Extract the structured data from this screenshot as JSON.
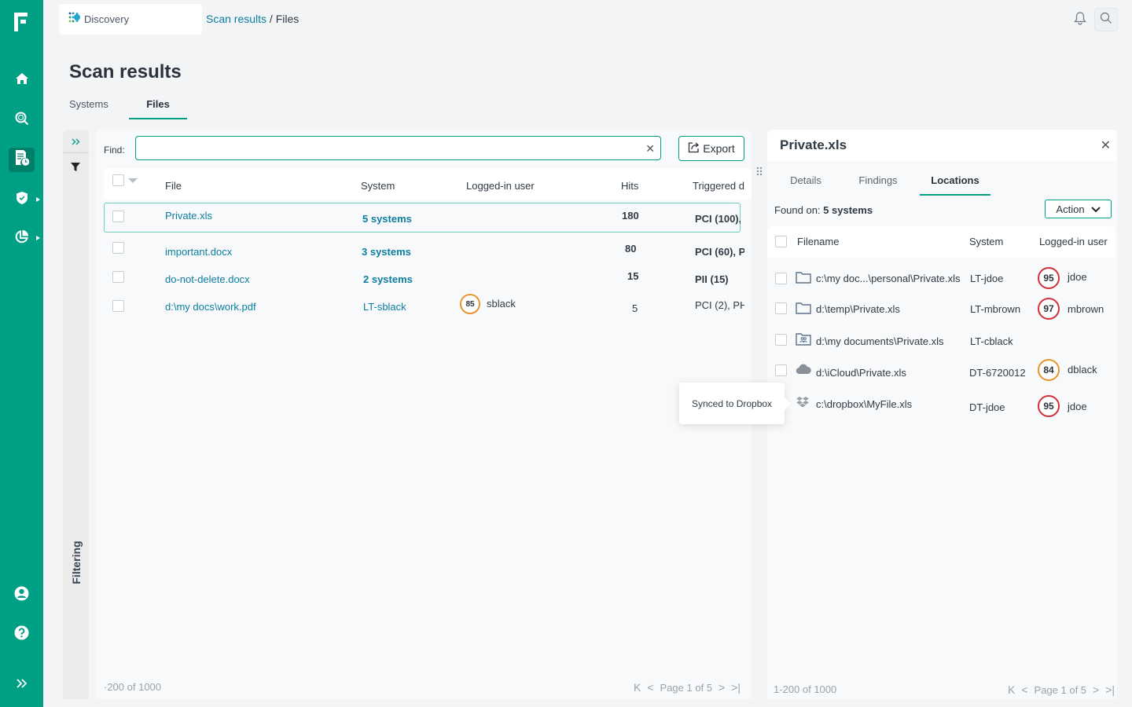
{
  "app": {
    "name": "Discovery",
    "accent_color": "#00a085",
    "link_color": "#0b7ea0"
  },
  "breadcrumb": {
    "parent": "Scan results",
    "separator": " / ",
    "current": "Files"
  },
  "nav": {
    "items": [
      {
        "id": "home",
        "icon": "home-icon"
      },
      {
        "id": "search-scan",
        "icon": "magnify-icon"
      },
      {
        "id": "scan-reports",
        "icon": "report-clock-icon",
        "active": true
      },
      {
        "id": "security",
        "icon": "shield-check-icon",
        "has_submenu": true
      },
      {
        "id": "analytics",
        "icon": "pie-chart-icon",
        "has_submenu": true
      },
      {
        "id": "profile",
        "icon": "user-icon"
      },
      {
        "id": "help",
        "icon": "help-icon"
      },
      {
        "id": "expand",
        "icon": "chevrons-right-icon"
      }
    ]
  },
  "page": {
    "title": "Scan results",
    "tabs": [
      {
        "label": "Systems",
        "active": false
      },
      {
        "label": "Files",
        "active": true
      }
    ]
  },
  "filter_sidebar": {
    "label": "Filtering"
  },
  "files_table": {
    "find_label": "Find:",
    "find_value": "",
    "export_label": "Export",
    "columns": [
      "File",
      "System",
      "Logged-in user",
      "Hits",
      "Triggered d"
    ],
    "rows": [
      {
        "file": "Private.xls",
        "system": "5 systems",
        "user": "",
        "score": null,
        "hits": "180",
        "triggered": "PCI (100),",
        "selected": true,
        "system_bold": true,
        "triggered_bold": true
      },
      {
        "file": "important.docx",
        "system": "3 systems",
        "user": "",
        "score": null,
        "hits": "80",
        "triggered": "PCI (60), P",
        "selected": false,
        "system_bold": true,
        "triggered_bold": true
      },
      {
        "file": "do-not-delete.docx",
        "system": "2 systems",
        "user": "",
        "score": null,
        "hits": "15",
        "triggered": "PII (15)",
        "selected": false,
        "system_bold": true,
        "triggered_bold": true
      },
      {
        "file": "d:\\my docs\\work.pdf",
        "system": "LT-sblack",
        "user": "sblack",
        "score": "85",
        "hits": "5",
        "triggered": "PCI (2), PH",
        "selected": false,
        "system_bold": false,
        "triggered_bold": false
      }
    ],
    "footer_count": "·200 of 1000",
    "pager": "Page 1 of 5"
  },
  "detail_panel": {
    "title": "Private.xls",
    "tabs": [
      {
        "label": "Details",
        "active": false
      },
      {
        "label": "Findings",
        "active": false
      },
      {
        "label": "Locations",
        "active": true
      }
    ],
    "found_on_label": "Found on:",
    "found_on_value": "5 systems",
    "action_label": "Action",
    "columns": [
      "Filename",
      "System",
      "Logged-in user"
    ],
    "rows": [
      {
        "icon": "folder-icon",
        "filename": "c:\\my doc...\\personal\\Private.xls",
        "system": "LT-jdoe",
        "score": "95",
        "risk": "high",
        "user": "jdoe"
      },
      {
        "icon": "folder-icon",
        "filename": "d:\\temp\\Private.xls",
        "system": "LT-mbrown",
        "score": "97",
        "risk": "high",
        "user": "mbrown"
      },
      {
        "icon": "shared-folder-icon",
        "filename": "d:\\my documents\\Private.xls",
        "system": "LT-cblack",
        "score": null,
        "risk": null,
        "user": ""
      },
      {
        "icon": "cloud-icon",
        "filename": "d:\\iCloud\\Private.xls",
        "system": "DT-6720012",
        "score": "84",
        "risk": "medium",
        "user": "dblack"
      },
      {
        "icon": "dropbox-icon",
        "filename": "c:\\dropbox\\MyFile.xls",
        "system": "DT-jdoe",
        "score": "95",
        "risk": "high",
        "user": "jdoe"
      }
    ],
    "footer_count": "1-200 of 1000",
    "pager": "Page 1 of 5"
  },
  "tooltip": {
    "text": "Synced to Dropbox"
  },
  "colors": {
    "risk_high": "#d2303a",
    "risk_medium": "#e8942d"
  }
}
